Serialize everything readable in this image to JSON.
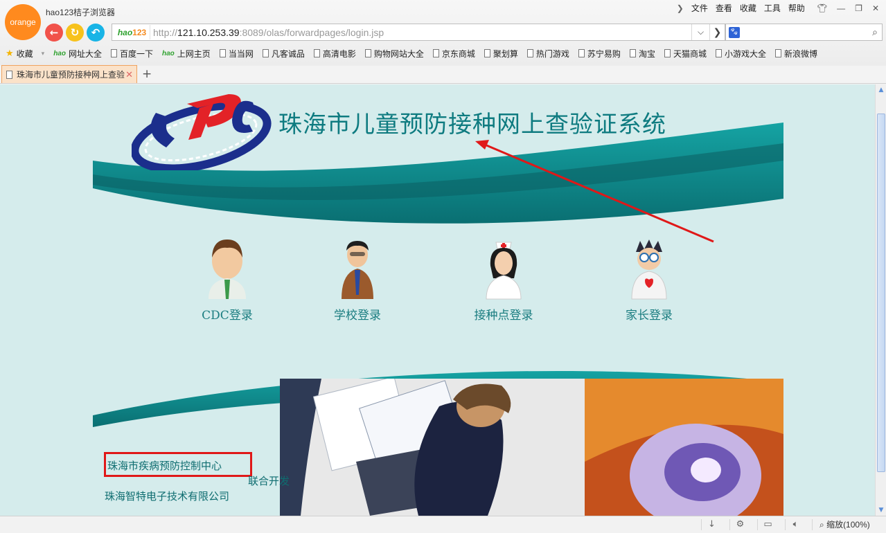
{
  "browser": {
    "logo_text": "orange",
    "app_title": "hao123桔子浏览器",
    "menu": [
      "文件",
      "查看",
      "收藏",
      "工具",
      "帮助"
    ],
    "address": {
      "badge_hao": "hao",
      "badge_num": "123",
      "url_prefix": "http://",
      "url_host": "121.10.253.39",
      "url_rest": ":8089/olas/forwardpages/login.jsp"
    },
    "bookmarks": [
      "收藏",
      "网址大全",
      "百度一下",
      "上网主页",
      "当当网",
      "凡客诚品",
      "高清电影",
      "购物网站大全",
      "京东商城",
      "聚划算",
      "热门游戏",
      "苏宁易购",
      "淘宝",
      "天猫商城",
      "小游戏大全",
      "新浪微博"
    ],
    "tab_title": "珠海市儿童预防接种网上查验",
    "zoom_text": "缩放(100%)"
  },
  "page": {
    "title": "珠海市儿童预防接种网上查验证系统",
    "logins": [
      "CDC登录",
      "学校登录",
      "接种点登录",
      "家长登录"
    ],
    "footer": {
      "org": "珠海市疾病预防控制中心",
      "joint": "联合开发",
      "company": "珠海智特电子技术有限公司"
    }
  },
  "colors": {
    "accent_teal": "#0e7b80",
    "arrow_red": "#e01818",
    "highlight_box": "#e01818"
  }
}
